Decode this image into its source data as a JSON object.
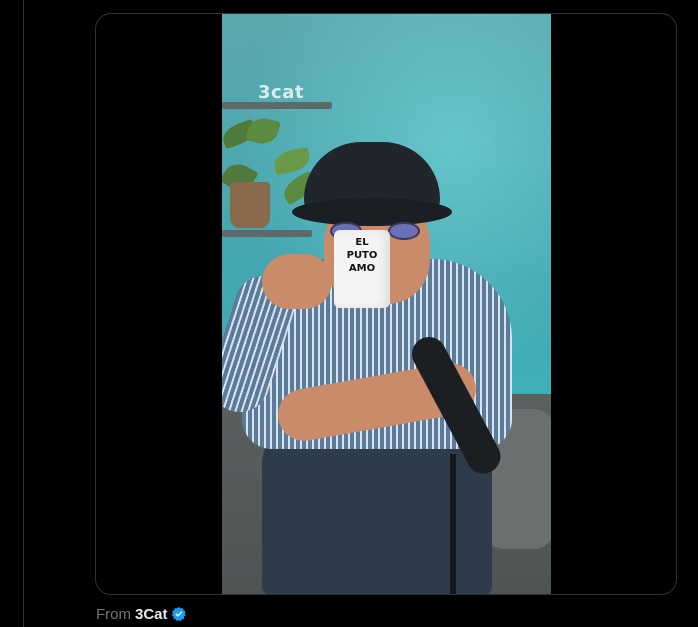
{
  "video": {
    "watermark": "3cat",
    "mug_text": [
      "EL",
      "PUTO",
      "AMO"
    ]
  },
  "attribution": {
    "prefix": "From",
    "source": "3Cat",
    "verified_icon": "verified-badge-icon",
    "verified_color": "#1d9bf0"
  },
  "colors": {
    "background": "#000000",
    "border": "#2f3336",
    "muted_text": "#71767b",
    "primary_text": "#e7e9ea"
  }
}
